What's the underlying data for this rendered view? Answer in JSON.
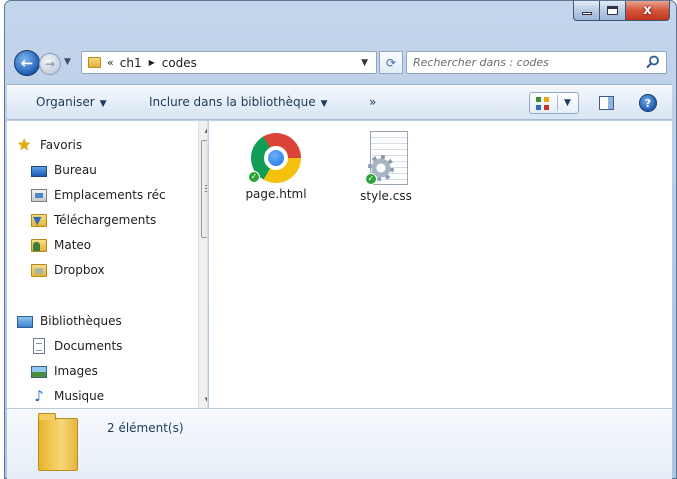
{
  "window": {
    "controls": {
      "minimize_icon": "minimize-icon",
      "maximize_icon": "maximize-icon",
      "close_glyph": "x"
    }
  },
  "address_bar": {
    "overflow_marker": "«",
    "path": [
      "ch1",
      "codes"
    ],
    "refresh_glyph": "⟳"
  },
  "search": {
    "placeholder": "Rechercher dans : codes"
  },
  "toolbar": {
    "organize_label": "Organiser",
    "include_label": "Inclure dans la bibliothèque",
    "more_label": "»",
    "help_glyph": "?"
  },
  "navigation": {
    "favorites": {
      "label": "Favoris",
      "items": [
        {
          "label": "Bureau",
          "icon": "desktop-icon"
        },
        {
          "label": "Emplacements réc",
          "icon": "recent-places-icon"
        },
        {
          "label": "Téléchargements",
          "icon": "downloads-folder-icon"
        },
        {
          "label": "Mateo",
          "icon": "user-folder-icon"
        },
        {
          "label": "Dropbox",
          "icon": "dropbox-folder-icon"
        }
      ]
    },
    "libraries": {
      "label": "Bibliothèques",
      "items": [
        {
          "label": "Documents",
          "icon": "documents-icon"
        },
        {
          "label": "Images",
          "icon": "images-icon"
        },
        {
          "label": "Musique",
          "icon": "music-icon"
        }
      ]
    }
  },
  "files": [
    {
      "name": "page.html",
      "icon": "chrome-html-file-icon",
      "status": "synced"
    },
    {
      "name": "style.css",
      "icon": "css-file-icon",
      "status": "synced"
    }
  ],
  "details": {
    "item_count": "2 élément(s)"
  },
  "colors": {
    "window_frame": "#b9cde6",
    "command_bar": "#e3ecf7",
    "selection_text": "#1e395b",
    "sync_ok": "#2fa43a"
  }
}
